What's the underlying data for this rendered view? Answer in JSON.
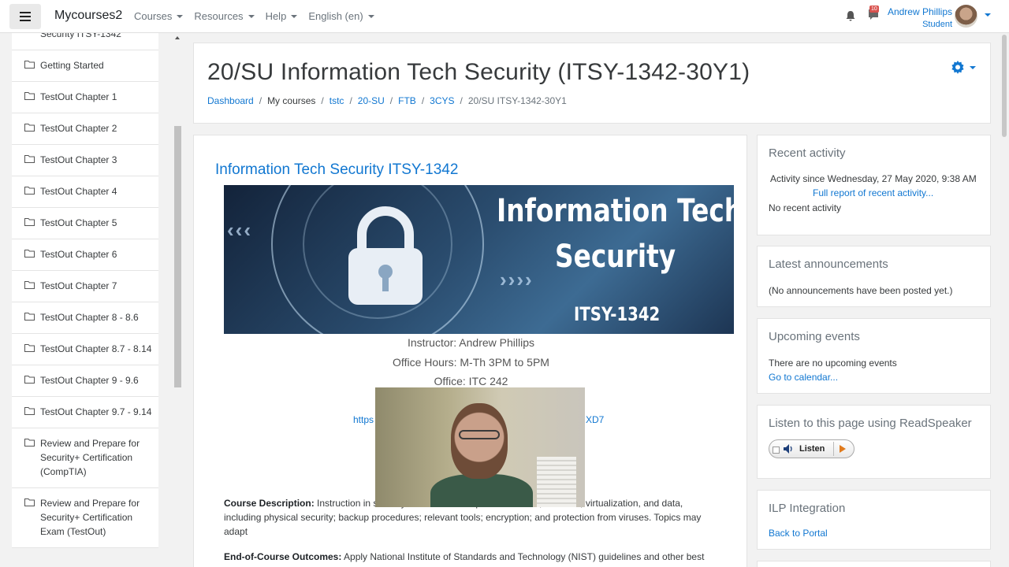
{
  "navbar": {
    "brand": "Mycourses2",
    "menu": [
      {
        "label": "Courses"
      },
      {
        "label": "Resources"
      },
      {
        "label": "Help"
      },
      {
        "label": "English (en)"
      }
    ],
    "message_badge": "10",
    "user_name": "Andrew Phillips",
    "user_role": "Student"
  },
  "drawer": {
    "items": [
      {
        "label": "Security ITSY-1342"
      },
      {
        "label": "Getting Started"
      },
      {
        "label": "TestOut Chapter 1"
      },
      {
        "label": "TestOut Chapter 2"
      },
      {
        "label": "TestOut Chapter 3"
      },
      {
        "label": "TestOut Chapter 4"
      },
      {
        "label": "TestOut Chapter 5"
      },
      {
        "label": "TestOut Chapter 6"
      },
      {
        "label": "TestOut Chapter 7"
      },
      {
        "label": "TestOut Chapter 8 - 8.6"
      },
      {
        "label": "TestOut Chapter 8.7 - 8.14"
      },
      {
        "label": "TestOut Chapter 9 - 9.6"
      },
      {
        "label": "TestOut Chapter 9.7 - 9.14"
      },
      {
        "label": "Review and Prepare for Security+ Certification (CompTIA)"
      },
      {
        "label": "Review and Prepare for Security+ Certification Exam (TestOut)"
      }
    ]
  },
  "header": {
    "title": "20/SU Information Tech Security (ITSY-1342-30Y1)",
    "breadcrumb": [
      {
        "label": "Dashboard"
      },
      {
        "label": "My courses"
      },
      {
        "label": "tstc"
      },
      {
        "label": "20-SU"
      },
      {
        "label": "FTB"
      },
      {
        "label": "3CYS"
      },
      {
        "label": "20/SU ITSY-1342-30Y1"
      }
    ]
  },
  "main": {
    "course_name": "Information Tech Security ITSY-1342",
    "banner": {
      "line1": "Information Tech",
      "line2": "Security",
      "code": "ITSY-1342"
    },
    "instructor": "Instructor:  Andrew Phillips",
    "office_hours": "Office Hours: M-Th 3PM to 5PM",
    "office": "Office: ITC 242",
    "link_start": "https",
    "link_end": "XD7",
    "course_desc_label": "Course Description:",
    "course_desc_text": " Instruction in security for network computer hardware, software, virtualization, and data, including physical security; backup procedures; relevant tools; encryption; and protection from viruses. Topics may adapt",
    "outcomes_label": "End-of-Course Outcomes:",
    "outcomes_text": " Apply National Institute of Standards and Technology (NIST) guidelines and other best"
  },
  "blocks": {
    "recent": {
      "title": "Recent activity",
      "since": "Activity since Wednesday, 27 May 2020, 9:38 AM",
      "full_report": "Full report of recent activity...",
      "none": "No recent activity"
    },
    "announcements": {
      "title": "Latest announcements",
      "none": "(No announcements have been posted yet.)"
    },
    "events": {
      "title": "Upcoming events",
      "none": "There are no upcoming events",
      "calendar": "Go to calendar..."
    },
    "readspeaker": {
      "title": "Listen to this page using ReadSpeaker",
      "listen": "Listen"
    },
    "ilp": {
      "title": "ILP Integration",
      "portal": "Back to Portal"
    }
  },
  "colors": {
    "link": "#1177d1",
    "badge": "#d9534f",
    "play": "#e07a1c"
  }
}
